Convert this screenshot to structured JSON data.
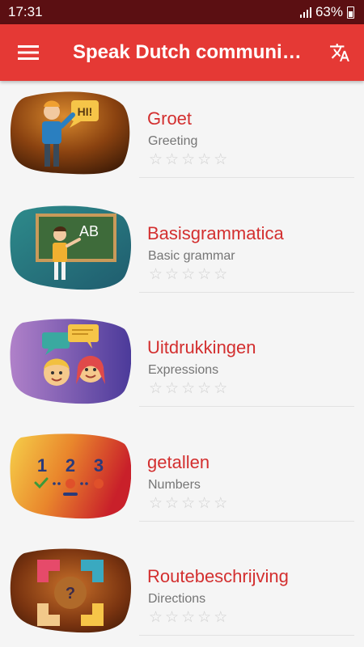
{
  "status": {
    "time": "17:31",
    "battery": "63%"
  },
  "appbar": {
    "title": "Speak Dutch communic..."
  },
  "icons": {
    "menu": "hamburger-menu-icon",
    "translate": "translate-icon",
    "star": "☆"
  },
  "lessons": [
    {
      "title": "Groet",
      "subtitle": "Greeting",
      "bubble_text": "HI!",
      "rating": 0,
      "max_rating": 5
    },
    {
      "title": "Basisgrammatica",
      "subtitle": "Basic grammar",
      "board_text": "AB",
      "rating": 0,
      "max_rating": 5
    },
    {
      "title": "Uitdrukkingen",
      "subtitle": "Expressions",
      "rating": 0,
      "max_rating": 5
    },
    {
      "title": "getallen",
      "subtitle": "Numbers",
      "digits": [
        "1",
        "2",
        "3"
      ],
      "rating": 0,
      "max_rating": 5
    },
    {
      "title": "Routebeschrijving",
      "subtitle": "Directions",
      "center_symbol": "?",
      "rating": 0,
      "max_rating": 5
    }
  ],
  "colors": {
    "status_bar": "#5b0f12",
    "app_bar": "#e53935",
    "title_text": "#d32f2f",
    "subtitle_text": "#757575",
    "star_empty": "#cfcfcf"
  }
}
